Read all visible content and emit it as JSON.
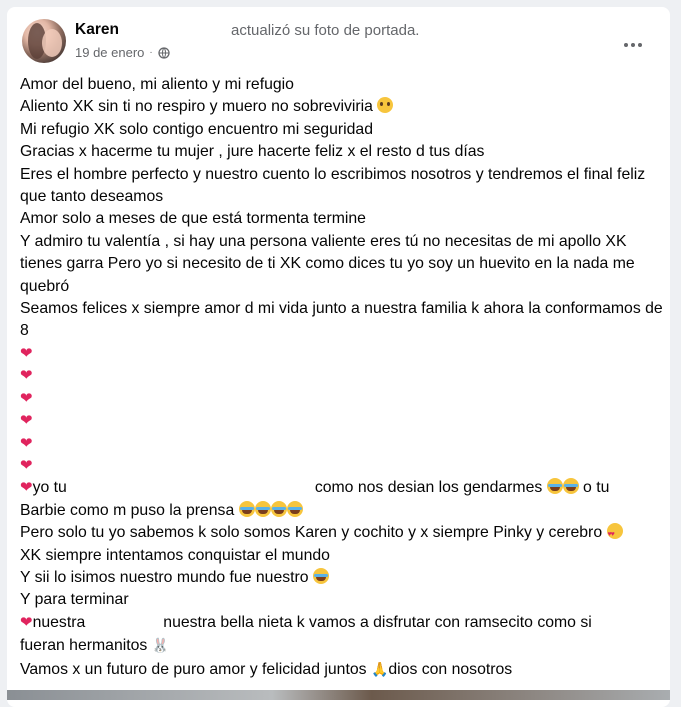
{
  "post": {
    "author": "Karen",
    "action": "actualizó su foto de portada.",
    "date": "19 de enero",
    "separator": "·",
    "audience_icon": "globe-icon",
    "more_icon": "more-options-icon",
    "lines": [
      "Amor del bueno, mi aliento y mi refugio",
      "Aliento XK sin ti no respiro y muero no sobreviviria",
      "Mi refugio XK solo contigo encuentro mi seguridad",
      "Gracias x hacerme tu mujer , jure hacerte feliz x el resto d tus días",
      "Eres el hombre perfecto y nuestro cuento lo escribimos nosotros y tendremos el final feliz que tanto deseamos",
      "Amor solo a meses de que está tormenta termine",
      "Y admiro tu valentía , si hay una persona valiente eres tú no necesitas de mi apollo XK tienes garra Pero yo si necesito de ti XK como dices tu yo soy un huevito en la nada me quebró",
      "Seamos felices x siempre amor d mi vida junto a nuestra familia k ahora la conformamos de 8"
    ],
    "line_yo_tu_a": "yo tu",
    "line_yo_tu_b": "como nos desian los gendarmes",
    "line_yo_tu_c": "o tu",
    "line_barbie": "Barbie como m puso la prensa",
    "line_pinky": "Pero solo tu yo sabemos k solo somos Karen y cochito y x siempre Pinky y cerebro",
    "line_conquistar": "XK siempre intentamos conquistar el mundo",
    "line_sii": "Y sii lo isimos nuestro mundo fue nuestro",
    "line_terminar": "Y para terminar",
    "line_nuestra_a": "nuestra",
    "line_nuestra_b": "nuestra bella nieta k vamos a disfrutar con ramsecito como si",
    "line_hermanitos": "fueran hermanitos",
    "line_futuro_a": "Vamos x un futuro de puro amor y felicidad juntos",
    "line_futuro_b": "dios con nosotros",
    "heart_glyph": "❤",
    "pray_glyph": "🙏",
    "bunny_glyph": "🐰"
  },
  "colors": {
    "background": "#eef0f3",
    "card": "#ffffff",
    "text": "#050505",
    "secondary": "#65676b",
    "heart": "#e0245e"
  }
}
